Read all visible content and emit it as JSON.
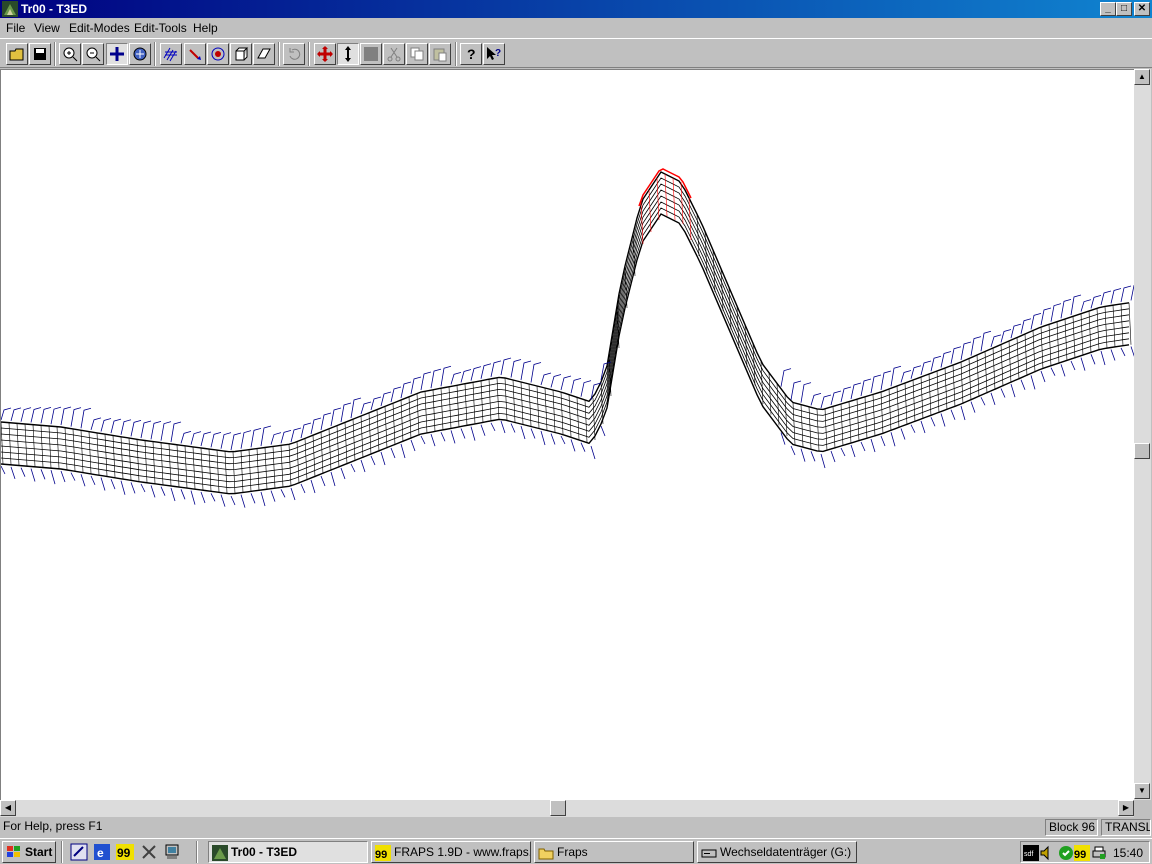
{
  "window": {
    "title": "Tr00 - T3ED",
    "min_label": "_",
    "max_label": "□",
    "close_label": "✕"
  },
  "menu": [
    "File",
    "View",
    "Edit-Modes",
    "Edit-Tools",
    "Help"
  ],
  "toolbar": {
    "buttons": [
      "open-icon",
      "save-icon",
      "zoom-in-icon",
      "zoom-out-icon",
      "move-view-icon",
      "rotate-view-icon",
      "track-mesh-icon",
      "select-icon",
      "target-icon",
      "block-icon",
      "object-icon",
      "undo-icon",
      "translate-icon",
      "vertical-move-icon",
      "color-icon",
      "cut-icon",
      "copy-icon",
      "paste-icon",
      "help-icon",
      "context-help-icon"
    ]
  },
  "status": {
    "help": "For Help, press F1",
    "block": "Block 96",
    "mode": "TRANSL"
  },
  "taskbar": {
    "start": "Start",
    "tasks": [
      {
        "label": "Tr00 - T3ED",
        "icon": "t3ed-app-icon",
        "active": true
      },
      {
        "label": "FRAPS 1.9D - www.fraps...",
        "icon": "fraps-icon",
        "active": false
      },
      {
        "label": "Fraps",
        "icon": "folder-icon",
        "active": false
      },
      {
        "label": "Wechseldatenträger (G:)",
        "icon": "drive-icon",
        "active": false
      }
    ],
    "tray_icons": [
      "sdf-tray-icon",
      "volume-tray-icon",
      "network-tray-icon",
      "fraps-tray-icon",
      "printer-tray-icon"
    ],
    "clock": "15:40"
  },
  "colors": {
    "titlebar": "#000080",
    "mesh": "#000000",
    "edge_objects": "#00008b",
    "selected": "#ff0000",
    "face": "#c0c0c0"
  }
}
